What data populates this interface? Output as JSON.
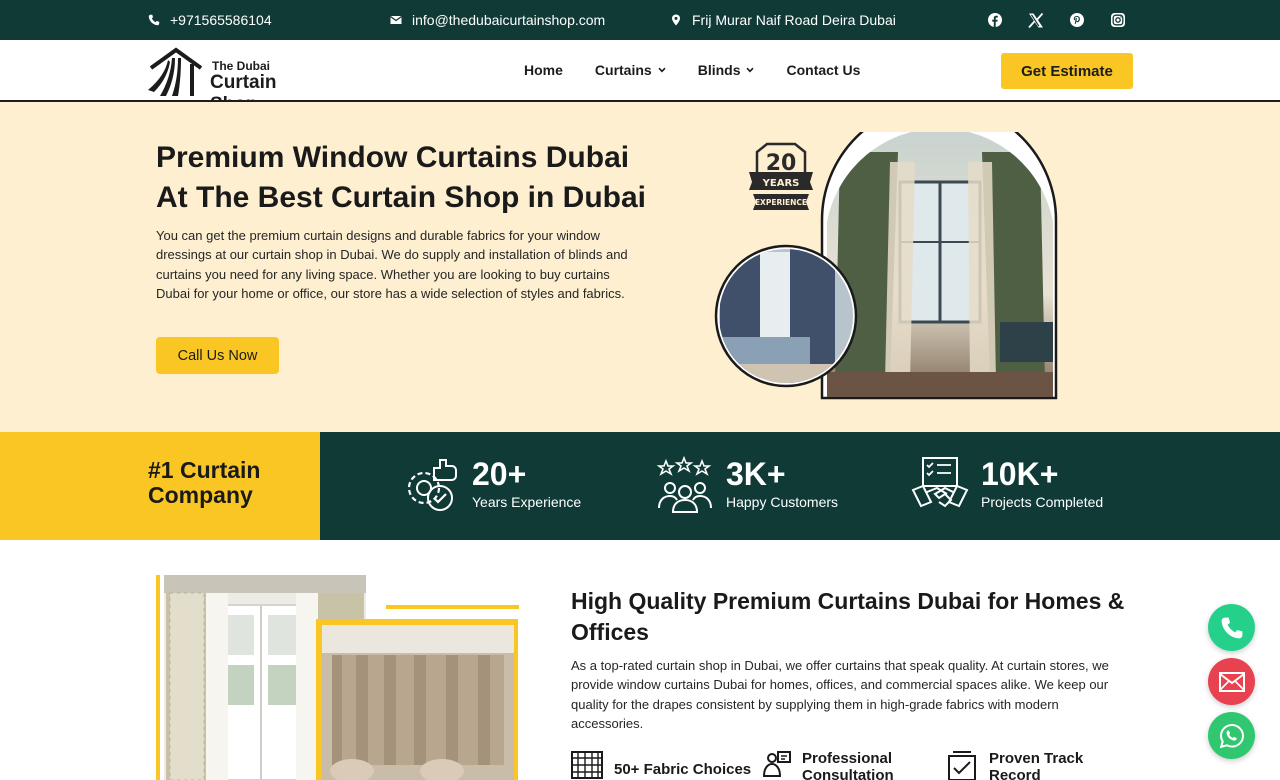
{
  "topbar": {
    "phone": "+971565586104",
    "email": "info@thedubaicurtainshop.com",
    "address": "Frij Murar Naif Road Deira Dubai",
    "social_icons": [
      "facebook-icon",
      "x-icon",
      "pinterest-icon",
      "instagram-icon"
    ]
  },
  "header": {
    "logo_small": "The Dubai",
    "logo_big": "Curtain Shop",
    "nav": [
      {
        "label": "Home",
        "has_dropdown": false
      },
      {
        "label": "Curtains",
        "has_dropdown": true
      },
      {
        "label": "Blinds",
        "has_dropdown": true
      },
      {
        "label": "Contact Us",
        "has_dropdown": false
      }
    ],
    "cta": "Get Estimate"
  },
  "hero": {
    "title": "Premium Window Curtains Dubai At The Best Curtain Shop in Dubai",
    "text": "You can get the premium curtain designs and durable fabrics for your window dressings at our curtain shop in Dubai. We do supply and installation of blinds and curtains you need for any living space. Whether you are looking to buy curtains Dubai for your home or office, our store has a wide selection of styles and fabrics.",
    "cta": "Call Us Now",
    "badge_number": "20",
    "badge_years": "YEARS",
    "badge_experience": "EXPERIENCE"
  },
  "stats": {
    "heading": "#1 Curtain Company",
    "items": [
      {
        "number": "20+",
        "label": "Years Experience",
        "icon": "gear-thumbs-up-icon"
      },
      {
        "number": "3K+",
        "label": "Happy Customers",
        "icon": "customers-stars-icon"
      },
      {
        "number": "10K+",
        "label": "Projects Completed",
        "icon": "handshake-icon"
      }
    ]
  },
  "section": {
    "title": "High Quality Premium Curtains Dubai for Homes & Offices",
    "text": "As a top-rated curtain shop in Dubai, we offer curtains that speak quality. At curtain stores, we provide window curtains Dubai for homes, offices, and commercial spaces alike. We keep our quality for the drapes consistent by supplying them in high-grade fabrics with modern accessories.",
    "features": [
      {
        "label": "50+ Fabric Choices",
        "icon": "fabric-icon"
      },
      {
        "label": "Professional Consultation",
        "icon": "consultation-icon"
      },
      {
        "label": "Proven Track Record",
        "icon": "track-record-icon"
      }
    ]
  },
  "colors": {
    "dark_green": "#0f3a36",
    "yellow": "#f9c623",
    "cream": "#fdefd0",
    "phone_fab": "#25d08a",
    "email_fab": "#e8414f",
    "whatsapp_fab": "#31c770"
  }
}
